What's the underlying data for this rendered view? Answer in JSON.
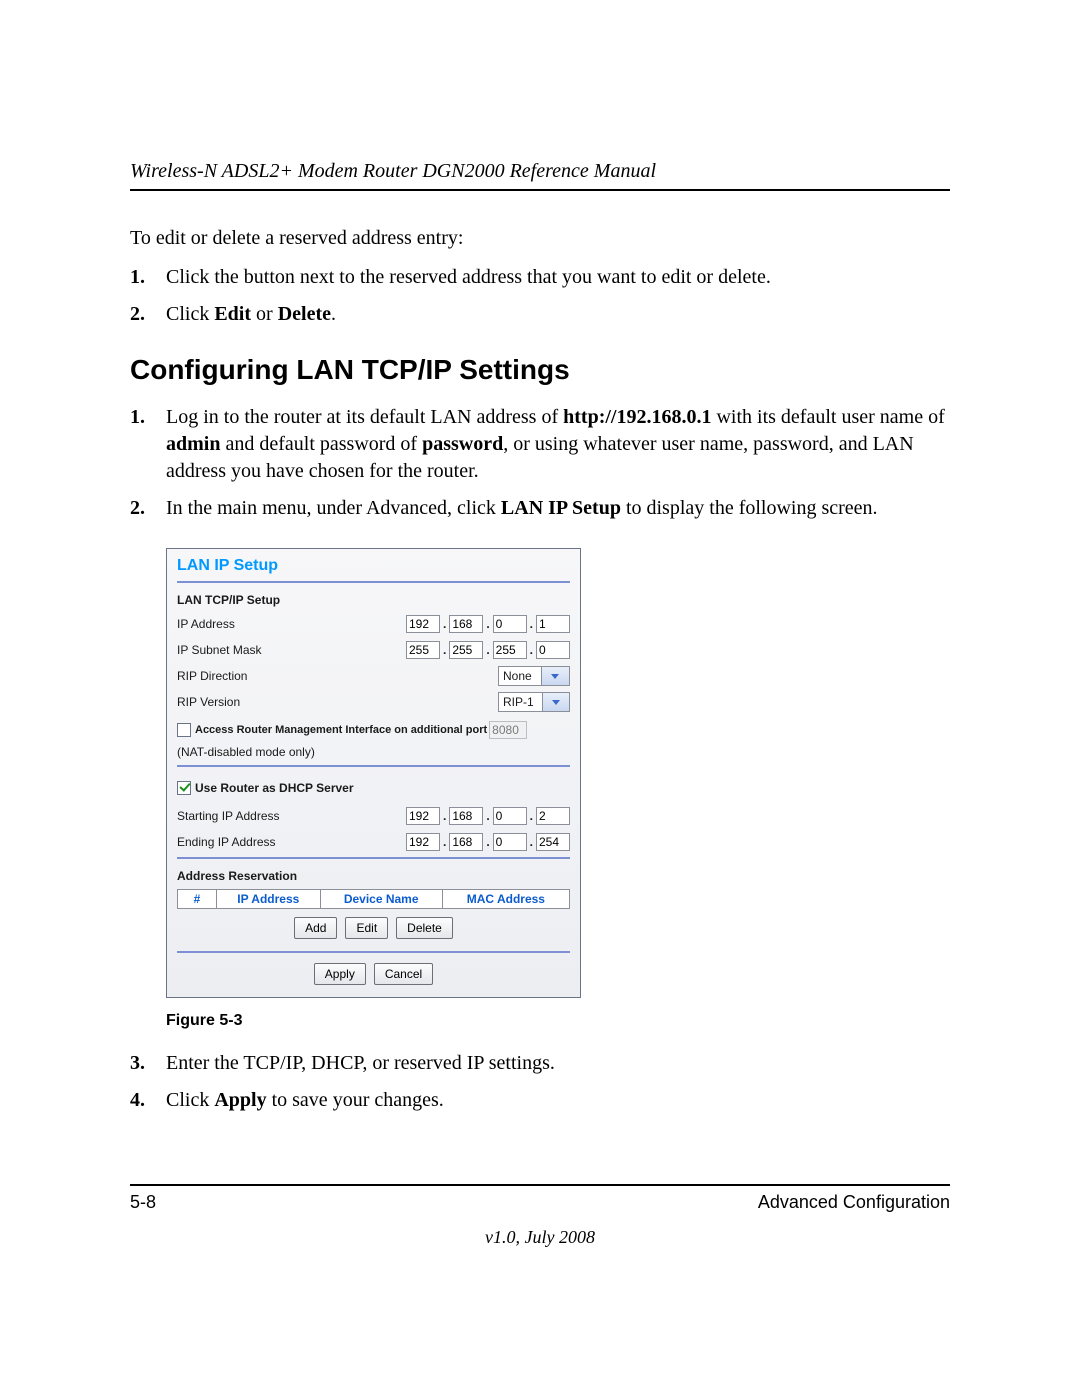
{
  "header": {
    "running": "Wireless-N ADSL2+ Modem Router DGN2000 Reference Manual"
  },
  "intro": "To edit or delete a reserved address entry:",
  "list_a": [
    {
      "num": "1.",
      "plain": "Click the button next to the reserved address that you want to edit or delete."
    },
    {
      "num": "2.",
      "prefix": "Click ",
      "bold1": "Edit",
      "mid": " or ",
      "bold2": "Delete",
      "suffix": "."
    }
  ],
  "heading": "Configuring LAN TCP/IP Settings",
  "list_b": [
    {
      "num": "1.",
      "seg1": "Log in to the router at its default LAN address of ",
      "bold1": "http://192.168.0.1",
      "seg2": " with its default user name of ",
      "bold2": "admin",
      "seg3": " and default password of ",
      "bold3": "password",
      "seg4": ", or using whatever user name, password, and LAN address you have chosen for the router."
    },
    {
      "num": "2.",
      "seg1": "In the main menu, under Advanced, click ",
      "bold1": "LAN IP Setup",
      "seg2": " to display the following screen."
    }
  ],
  "panel": {
    "title": "LAN IP Setup",
    "sec1": "LAN TCP/IP Setup",
    "ip_label": "IP Address",
    "ip": [
      "192",
      "168",
      "0",
      "1"
    ],
    "mask_label": "IP Subnet Mask",
    "mask": [
      "255",
      "255",
      "255",
      "0"
    ],
    "ripdir_label": "RIP Direction",
    "ripdir_value": "None",
    "ripver_label": "RIP Version",
    "ripver_value": "RIP-1",
    "accessport_label": "Access Router Management Interface on additional port",
    "accessport_value": "8080",
    "nat_note": "(NAT-disabled mode only)",
    "dhcp_label": "Use Router as DHCP Server",
    "start_label": "Starting IP Address",
    "start": [
      "192",
      "168",
      "0",
      "2"
    ],
    "end_label": "Ending IP Address",
    "end": [
      "192",
      "168",
      "0",
      "254"
    ],
    "resv_title": "Address Reservation",
    "resv_cols": {
      "n": "#",
      "ip": "IP Address",
      "dev": "Device Name",
      "mac": "MAC Address"
    },
    "btn_add": "Add",
    "btn_edit": "Edit",
    "btn_delete": "Delete",
    "btn_apply": "Apply",
    "btn_cancel": "Cancel"
  },
  "figure_caption": "Figure 5-3",
  "list_c": [
    {
      "num": "3.",
      "plain": "Enter the TCP/IP, DHCP, or reserved IP settings."
    },
    {
      "num": "4.",
      "prefix": "Click ",
      "bold1": "Apply",
      "suffix": " to save your changes."
    }
  ],
  "footer": {
    "left": "5-8",
    "right": "Advanced Configuration",
    "version": "v1.0, July 2008"
  }
}
